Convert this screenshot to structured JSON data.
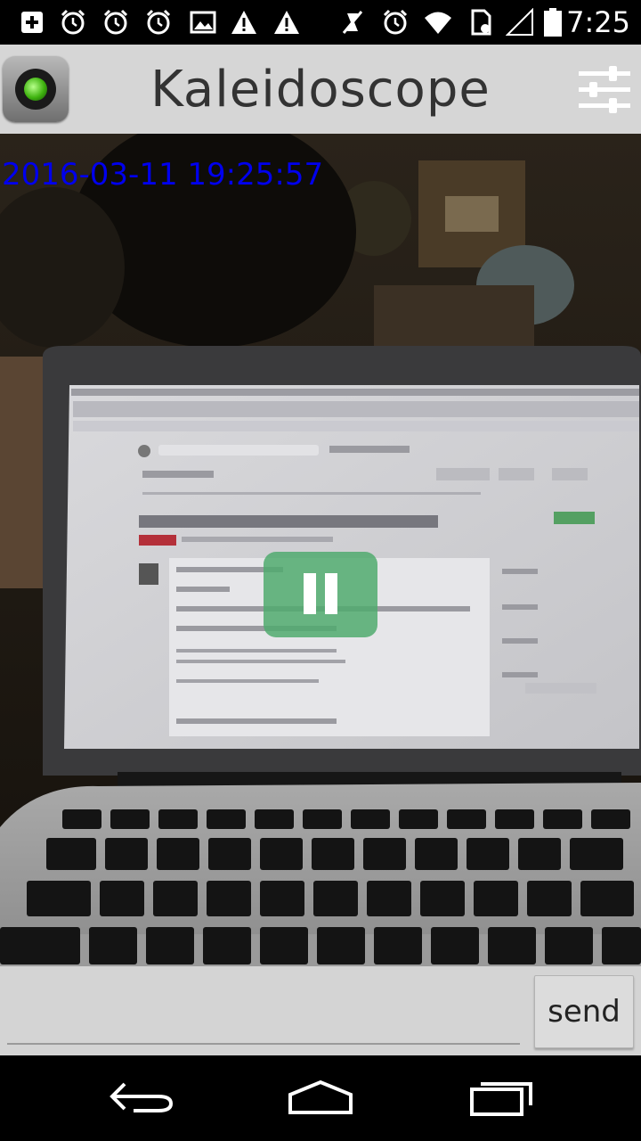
{
  "status_bar": {
    "time": "7:25",
    "icons": [
      "add-notification-icon",
      "alarm-icon",
      "alarm-icon",
      "alarm-icon",
      "image-icon",
      "warning-icon",
      "warning-icon",
      "mute-icon",
      "alarm-icon",
      "wifi-icon",
      "sim-icon",
      "signal-icon",
      "battery-icon"
    ]
  },
  "app_bar": {
    "title": "Kaleidoscope",
    "app_icon": "camera-lens-icon",
    "settings_icon": "sliders-icon"
  },
  "camera": {
    "timestamp": "2016-03-11 19:25:57",
    "timestamp_color": "#0000ee",
    "pause_icon": "pause-icon",
    "pause_color": "#50aa6e"
  },
  "message": {
    "value": "",
    "placeholder": "",
    "send_label": "send"
  },
  "nav_bar": {
    "icons": [
      "back-icon",
      "home-icon",
      "recents-icon"
    ]
  }
}
